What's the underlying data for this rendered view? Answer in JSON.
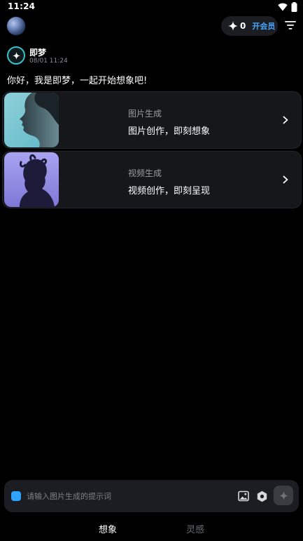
{
  "status_bar": {
    "time": "11:24"
  },
  "header": {
    "credits_count": "0",
    "vip_label": "开会员"
  },
  "message": {
    "bot_name": "即梦",
    "timestamp": "08/01 11:24",
    "greeting": "你好，我是即梦，一起开始想象吧!"
  },
  "cards": [
    {
      "title": "图片生成",
      "subtitle": "图片创作，即刻想象"
    },
    {
      "title": "视频生成",
      "subtitle": "视频创作，即刻呈现"
    }
  ],
  "input": {
    "placeholder": "请输入图片生成的提示词",
    "value": ""
  },
  "tabs": [
    {
      "label": "想象",
      "active": true
    },
    {
      "label": "灵感",
      "active": false
    }
  ],
  "icons": {
    "wifi": "wifi-icon",
    "battery": "battery-icon",
    "credits": "sparkle-icon",
    "filter": "filter-icon",
    "bot": "sparkle-icon",
    "arrow": "chevron-right-icon",
    "image": "image-icon",
    "settings": "hexagon-settings-icon",
    "send": "sparkle-icon"
  },
  "colors": {
    "background": "#000000",
    "card_background": "#15171b",
    "accent_blue": "#4aa6ff",
    "bot_ring": "#35c1cc",
    "input_dot": "#2fa3ff"
  }
}
